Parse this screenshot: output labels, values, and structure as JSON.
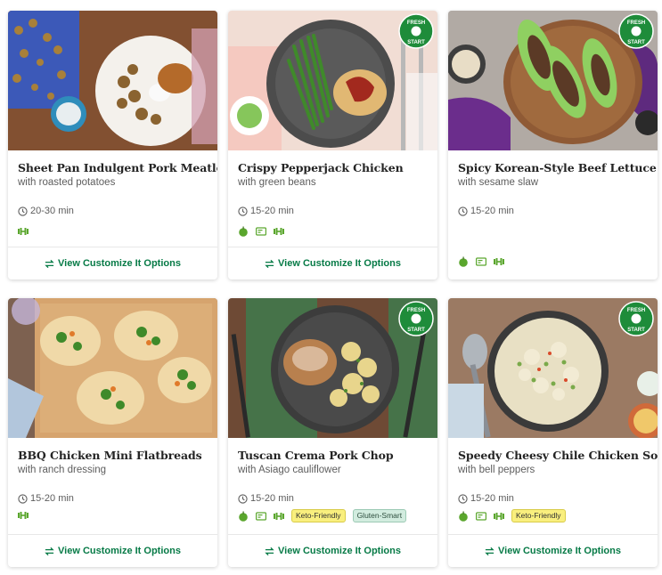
{
  "colors": {
    "accent": "#067a46",
    "icon_green": "#5aa62d",
    "badge_green": "#1e8c3a"
  },
  "badge_text": [
    "FRESH",
    "START"
  ],
  "recipes": [
    {
      "title": "Sheet Pan Indulgent Pork Meatloaf",
      "subtitle": "with roasted potatoes",
      "time": "20-30 min",
      "icons": [
        "protein-icon"
      ],
      "tags": [],
      "fresh_start": false,
      "action": "View Customize It Options"
    },
    {
      "title": "Crispy Pepperjack Chicken",
      "subtitle": "with green beans",
      "time": "15-20 min",
      "icons": [
        "apple-icon",
        "calorie-card-icon",
        "protein-icon"
      ],
      "tags": [],
      "fresh_start": true,
      "action": "View Customize It Options"
    },
    {
      "title": "Spicy Korean-Style Beef Lettuce Cups",
      "subtitle": "with sesame slaw",
      "time": "15-20 min",
      "icons": [
        "apple-icon",
        "calorie-card-icon",
        "protein-icon"
      ],
      "tags": [],
      "fresh_start": true,
      "action": ""
    },
    {
      "title": "BBQ Chicken Mini Flatbreads",
      "subtitle": "with ranch dressing",
      "time": "15-20 min",
      "icons": [
        "protein-icon"
      ],
      "tags": [],
      "fresh_start": false,
      "action": "View Customize It Options"
    },
    {
      "title": "Tuscan Crema Pork Chop",
      "subtitle": "with Asiago cauliflower",
      "time": "15-20 min",
      "icons": [
        "apple-icon",
        "calorie-card-icon",
        "protein-icon"
      ],
      "tags": [
        "Keto-Friendly",
        "Gluten-Smart"
      ],
      "fresh_start": true,
      "action": "View Customize It Options"
    },
    {
      "title": "Speedy Cheesy Chile Chicken Soup",
      "subtitle": "with bell peppers",
      "time": "15-20 min",
      "icons": [
        "apple-icon",
        "calorie-card-icon",
        "protein-icon"
      ],
      "tags": [
        "Keto-Friendly"
      ],
      "fresh_start": true,
      "action": "View Customize It Options"
    }
  ]
}
